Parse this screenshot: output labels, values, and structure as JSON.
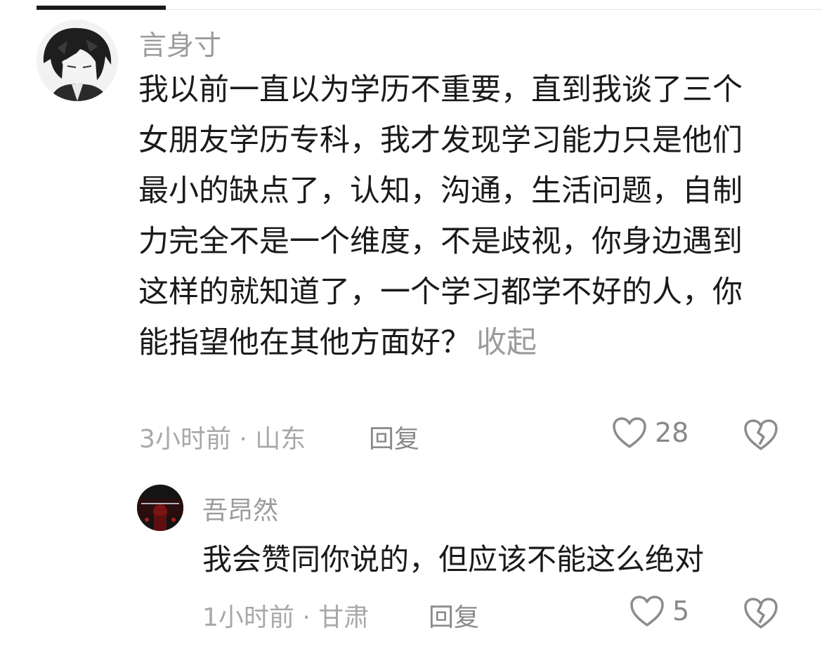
{
  "comments": [
    {
      "username": "言身寸",
      "avatar_icon": "anime-boy-avatar",
      "text": "我以前一直以为学历不重要，直到我谈了三个女朋友学历专科，我才发现学习能力只是他们最小的缺点了，认知，沟通，生活问题，自制力完全不是一个维度，不是歧视，你身边遇到这样的就知道了，一个学习都学不好的人，你能指望他在其他方面好？",
      "collapse_label": "收起",
      "meta": "3小时前 · 山东",
      "reply_label": "回复",
      "likes": "28"
    },
    {
      "username": "吾昂然",
      "avatar_icon": "dark-red-avatar",
      "text": "我会赞同你说的，但应该不能这么绝对",
      "meta": "1小时前 · 甘肃",
      "reply_label": "回复",
      "likes": "5"
    }
  ],
  "icons": {
    "like": "heart-outline-icon",
    "dislike": "broken-heart-icon"
  },
  "colors": {
    "text": "#1a1a1a",
    "muted": "#9b9b9b",
    "icon": "#8c8c8c"
  }
}
